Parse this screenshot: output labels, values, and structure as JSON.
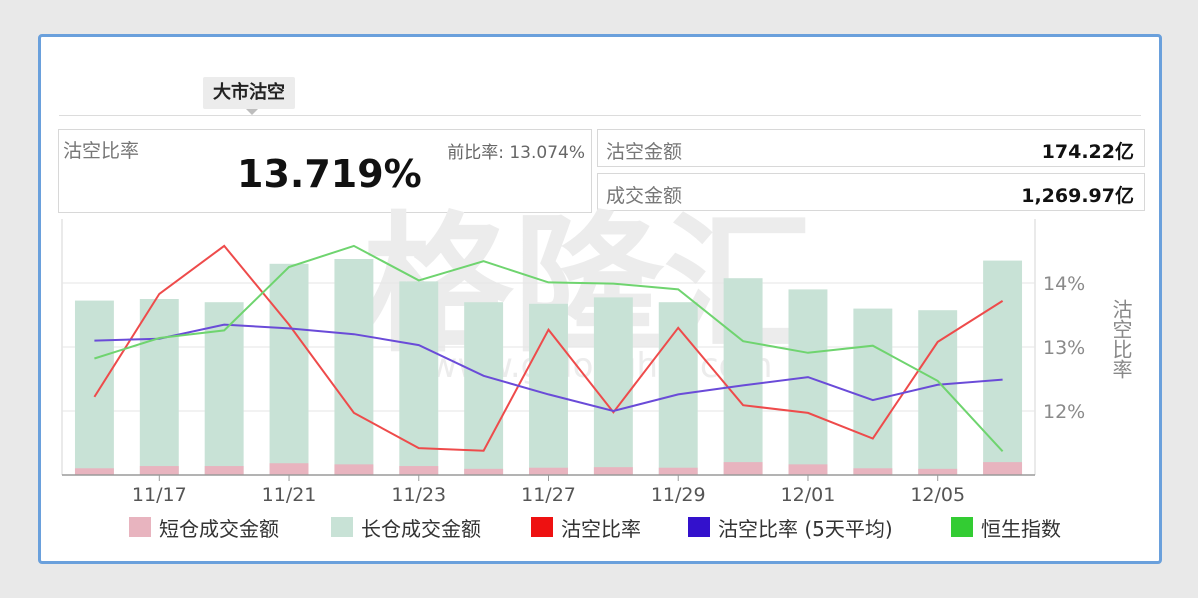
{
  "tab": {
    "label": "大市沽空"
  },
  "summary": {
    "ratio_label": "沽空比率",
    "ratio_value": "13.719%",
    "prev_ratio_label": "前比率:",
    "prev_ratio_value": "13.074%",
    "short_amount_label": "沽空金额",
    "short_amount_value": "174.22亿",
    "turnover_label": "成交金额",
    "turnover_value": "1,269.97亿"
  },
  "watermark": {
    "text": "格隆汇",
    "url": "www.gelonghui.com"
  },
  "colors": {
    "short_bar": "#e8b4bf",
    "long_bar": "#c8e2d6",
    "ratio_line": "#ee4b4b",
    "ratio5_line": "#6a4bd8",
    "hsi_line": "#6fd46f",
    "legend_ratio": "#ee1111",
    "legend_ratio5": "#3311cc",
    "legend_hsi": "#33cc33"
  },
  "chart_data": {
    "type": "bar+line",
    "ylabel": "沽空比率",
    "yticks": [
      "14%",
      "13%",
      "12%"
    ],
    "ytick_values": [
      14,
      13,
      12
    ],
    "ylim": [
      11.0,
      15.0
    ],
    "xtick_labels": [
      "11/17",
      "11/21",
      "11/23",
      "11/27",
      "11/29",
      "12/01",
      "12/05"
    ],
    "xtick_positions": [
      1,
      3,
      5,
      7,
      9,
      11,
      13
    ],
    "n_points": 15,
    "bar_max": 16,
    "series": [
      {
        "name": "短仓成交金额",
        "type": "bar",
        "values": [
          1.2,
          1.6,
          1.6,
          2.1,
          1.9,
          1.6,
          1.1,
          1.3,
          1.4,
          1.3,
          2.3,
          1.9,
          1.2,
          1.1,
          2.3
        ]
      },
      {
        "name": "长仓成交金额",
        "type": "bar",
        "values": [
          10.9,
          11.0,
          10.8,
          13.2,
          13.5,
          12.1,
          10.8,
          10.7,
          11.1,
          10.8,
          12.3,
          11.6,
          10.4,
          10.3,
          13.4
        ]
      },
      {
        "name": "沽空比率",
        "type": "line",
        "values": [
          12.22,
          13.83,
          14.58,
          13.35,
          11.97,
          11.42,
          11.38,
          13.27,
          11.98,
          13.3,
          12.09,
          11.97,
          11.57,
          13.08,
          13.72
        ]
      },
      {
        "name": "沽空比率 (5天平均)",
        "type": "line",
        "values": [
          13.1,
          13.13,
          13.35,
          13.29,
          13.2,
          13.03,
          12.55,
          12.26,
          12.0,
          12.26,
          12.4,
          12.53,
          12.17,
          12.41,
          12.49
        ]
      },
      {
        "name": "恒生指数",
        "type": "line",
        "values": [
          12.82,
          13.14,
          13.26,
          14.25,
          14.58,
          14.04,
          14.34,
          14.01,
          13.99,
          13.9,
          13.09,
          12.91,
          13.02,
          12.47,
          11.37
        ]
      }
    ],
    "legend_position": "bottom"
  }
}
